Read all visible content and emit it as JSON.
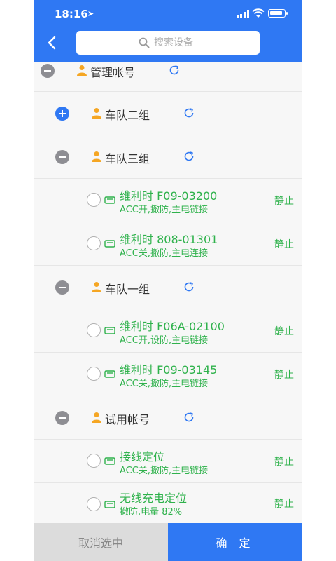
{
  "status_bar": {
    "time": "18:16"
  },
  "search": {
    "placeholder": "搜索设备"
  },
  "groups": [
    {
      "name": "管理帐号",
      "expanded": true
    },
    {
      "name": "车队二组",
      "expanded": false
    },
    {
      "name": "车队三组",
      "expanded": true
    },
    {
      "name": "车队一组",
      "expanded": true
    },
    {
      "name": "试用帐号",
      "expanded": true
    }
  ],
  "devices": [
    {
      "name": "维利时 F09-03200",
      "status": "ACC开,撤防,主电链接",
      "state": "静止"
    },
    {
      "name": "维利时 808-01301",
      "status": "ACC关,撤防,主电连接",
      "state": "静止"
    },
    {
      "name": "维利时 F06A-02100",
      "status": "ACC开,设防,主电链接",
      "state": "静止"
    },
    {
      "name": "维利时 F09-03145",
      "status": "ACC关,撤防,主电链接",
      "state": "静止"
    },
    {
      "name": "接线定位",
      "status": "ACC关,撤防,主电链接",
      "state": "静止"
    },
    {
      "name": "无线充电定位",
      "status": "撤防,电量 82%",
      "state": "静止"
    }
  ],
  "footer": {
    "cancel_label": "取消选中",
    "confirm_label": "确 定"
  },
  "colors": {
    "accent": "#2f78f3",
    "online_green": "#2fb24c",
    "person_orange": "#f5a623"
  },
  "icons": [
    "back-chevron-icon",
    "search-icon",
    "person-icon",
    "refresh-icon",
    "car-icon",
    "plus-circle-icon",
    "minus-circle-icon"
  ]
}
